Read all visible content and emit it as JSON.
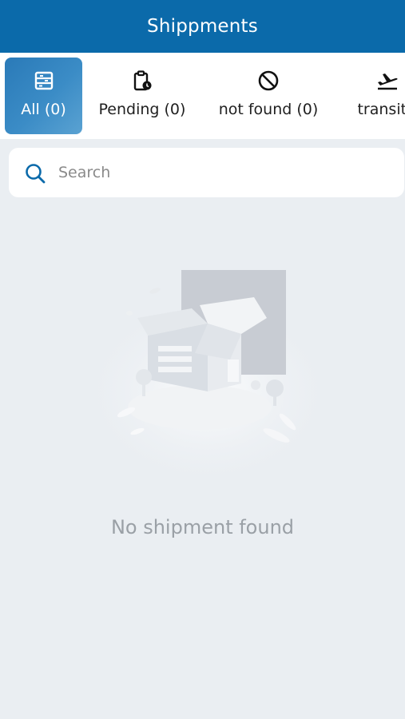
{
  "header": {
    "title": "Shippments"
  },
  "tabs": [
    {
      "label": "All (0)",
      "icon": "grid-package-icon",
      "active": true
    },
    {
      "label": "Pending (0)",
      "icon": "clipboard-clock-icon",
      "active": false
    },
    {
      "label": "not found (0)",
      "icon": "ban-icon",
      "active": false
    },
    {
      "label": "transit (",
      "icon": "airplane-takeoff-icon",
      "active": false
    }
  ],
  "search": {
    "placeholder": "Search",
    "value": ""
  },
  "empty_state": {
    "illustration": "open-box-warehouse-illustration",
    "message": "No shipment found"
  },
  "colors": {
    "primary": "#0b6aaa",
    "background": "#eaeef2",
    "muted_text": "#9aa0a6",
    "active_tab": "#2a7ab8"
  }
}
